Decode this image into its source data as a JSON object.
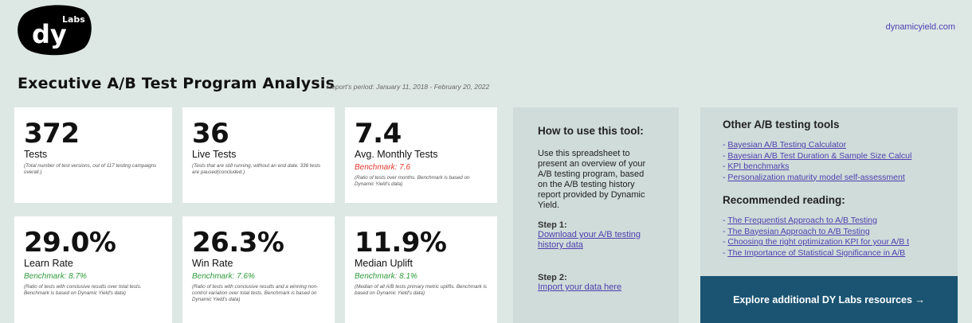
{
  "header": {
    "logo_text": "dy",
    "logo_sub": "Labs",
    "site_link": "dynamicyield.com",
    "title": "Executive A/B Test Program Analysis",
    "period": "Report's period: January 11, 2018 - February 20, 2022"
  },
  "metrics": [
    {
      "value": "372",
      "label": "Tests",
      "benchmark": "",
      "note": "(Total number of test versions, out of 117 testing campaigns overall.)"
    },
    {
      "value": "36",
      "label": "Live Tests",
      "benchmark": "",
      "note": "(Tests that are still running, without an end date. 336 tests are paused(concluded.)"
    },
    {
      "value": "7.4",
      "label": "Avg. Monthly Tests",
      "benchmark": "Benchmark: 7.6",
      "note": "(Ratio of tests over months. Benchmark is based on Dynamic Yield's data)"
    },
    {
      "value": "29.0%",
      "label": "Learn Rate",
      "benchmark": "Benchmark: 8.7%",
      "note": "(Ratio of tests with conclusive results over total tests. Benchmark is based on Dynamic Yield's data)"
    },
    {
      "value": "26.3%",
      "label": "Win Rate",
      "benchmark": "Benchmark: 7.6%",
      "note": "(Ratio of tests with conclusive results and a winning non-control variation over total tests. Benchmark is based on Dynamic Yield's data)"
    },
    {
      "value": "11.9%",
      "label": "Median Uplift",
      "benchmark": "Benchmark: 8.1%",
      "note": "(Median of all A/B tests primary metric uplifts. Benchmark is based on Dynamic Yield's data)"
    }
  ],
  "howto": {
    "title": "How to use this tool:",
    "description": "Use this spreadsheet to present an overview of your A/B testing program, based on the A/B testing history report provided by Dynamic Yield.",
    "step1_label": "Step 1:",
    "step1_link": "Download your A/B testing history data",
    "step2_label": "Step 2:",
    "step2_link": "Import your data here"
  },
  "tools": {
    "title": "Other A/B testing tools",
    "items": [
      "Bayesian A/B Testing Calculator",
      "Bayesian A/B Test Duration & Sample Size Calcul",
      "KPI benchmarks",
      "Personalization maturity model self-assessment"
    ],
    "reading_title": "Recommended reading:",
    "reading": [
      "The Frequentist Approach to A/B Testing",
      "The Bayesian Approach to A/B Testing",
      "Choosing the right optimization KPI for your A/B t",
      "The Importance of Statistical Significance in A/B"
    ]
  },
  "explore_button": "Explore additional DY Labs resources →",
  "colors": {
    "background": "#dde8e5",
    "panel": "#cfdcd9",
    "link": "#4f3fb0",
    "benchmark_red": "#e23a2e",
    "benchmark_green": "#2f9d3b",
    "button": "#1a5472"
  }
}
